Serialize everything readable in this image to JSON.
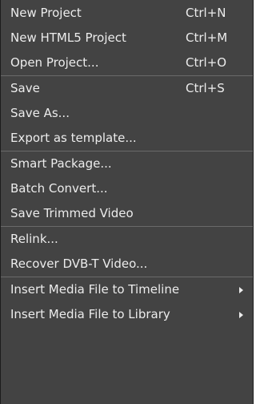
{
  "menu": {
    "groups": [
      {
        "items": [
          {
            "label": "New Project",
            "shortcut": "Ctrl+N"
          },
          {
            "label": "New HTML5 Project",
            "shortcut": "Ctrl+M"
          },
          {
            "label": "Open Project...",
            "shortcut": "Ctrl+O"
          }
        ]
      },
      {
        "items": [
          {
            "label": "Save",
            "shortcut": "Ctrl+S"
          },
          {
            "label": "Save As..."
          },
          {
            "label": "Export as template..."
          }
        ]
      },
      {
        "items": [
          {
            "label": "Smart Package..."
          },
          {
            "label": "Batch Convert..."
          },
          {
            "label": "Save Trimmed Video"
          }
        ]
      },
      {
        "items": [
          {
            "label": "Relink..."
          },
          {
            "label": "Recover DVB-T Video..."
          }
        ]
      },
      {
        "items": [
          {
            "label": "Insert Media File to Timeline",
            "submenu_icon": "submenu-arrow-icon"
          },
          {
            "label": "Insert Media File to Library",
            "submenu_icon": "submenu-arrow-icon"
          }
        ]
      }
    ]
  }
}
